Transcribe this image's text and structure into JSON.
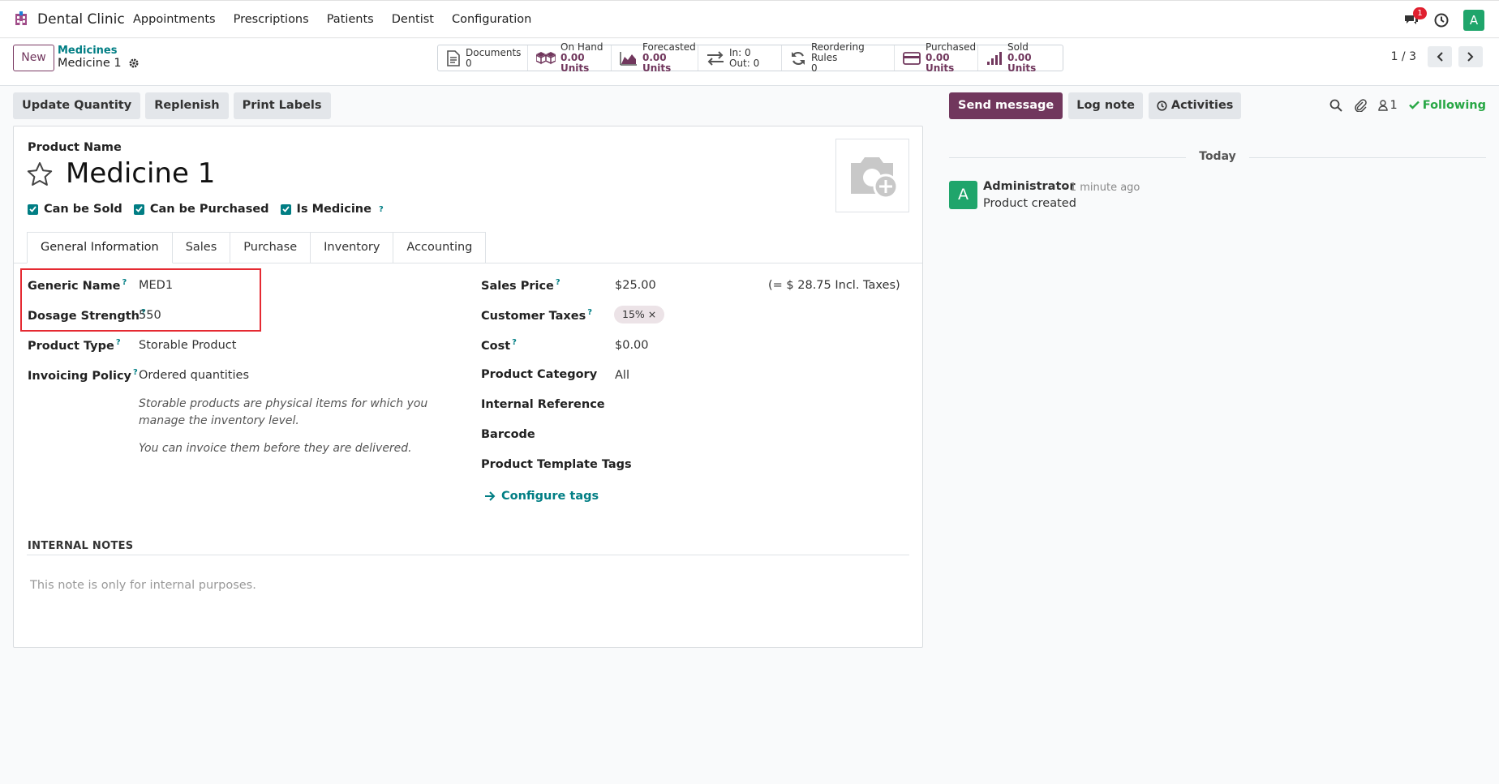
{
  "navbar": {
    "brand": "Dental Clinic",
    "menu": [
      "Appointments",
      "Prescriptions",
      "Patients",
      "Dentist",
      "Configuration"
    ],
    "chat_badge": "1",
    "user_initial": "A"
  },
  "control_panel": {
    "new_label": "New",
    "breadcrumb_parent": "Medicines",
    "breadcrumb_current": "Medicine 1",
    "smart_buttons": {
      "documents": {
        "label": "Documents",
        "value": "0"
      },
      "on_hand": {
        "label": "On Hand",
        "value": "0.00 Units"
      },
      "forecasted": {
        "label": "Forecasted",
        "value": "0.00 Units"
      },
      "in_out": {
        "in": "In: 0",
        "out": "Out: 0"
      },
      "reordering": {
        "label": "Reordering Rules",
        "value": "0"
      },
      "purchased": {
        "label": "Purchased",
        "value": "0.00 Units"
      },
      "sold": {
        "label": "Sold",
        "value": "0.00 Units"
      }
    },
    "pager": "1 / 3"
  },
  "actions": {
    "update_quantity": "Update Quantity",
    "replenish": "Replenish",
    "print_labels": "Print Labels"
  },
  "form": {
    "product_name_label": "Product Name",
    "product_name": "Medicine 1",
    "checkboxes": {
      "can_be_sold": "Can be Sold",
      "can_be_purchased": "Can be Purchased",
      "is_medicine": "Is Medicine"
    },
    "tabs": [
      "General Information",
      "Sales",
      "Purchase",
      "Inventory",
      "Accounting"
    ],
    "left": {
      "generic_name_label": "Generic Name",
      "generic_name": "MED1",
      "dosage_label": "Dosage Strength",
      "dosage": "550",
      "product_type_label": "Product Type",
      "product_type": "Storable Product",
      "invoicing_label": "Invoicing Policy",
      "invoicing": "Ordered quantities",
      "help_1": "Storable products are physical items for which you manage the inventory level.",
      "help_2": "You can invoice them before they are delivered."
    },
    "right": {
      "sales_price_label": "Sales Price",
      "sales_price": "$25.00",
      "incl_taxes": "(= $ 28.75 Incl. Taxes)",
      "customer_taxes_label": "Customer Taxes",
      "customer_tax_tag": "15% ×",
      "cost_label": "Cost",
      "cost": "$0.00",
      "category_label": "Product Category",
      "category": "All",
      "internal_ref_label": "Internal Reference",
      "barcode_label": "Barcode",
      "tags_label": "Product Template Tags",
      "configure_tags": "Configure tags"
    },
    "notes_heading": "INTERNAL NOTES",
    "notes_placeholder": "This note is only for internal purposes."
  },
  "chatter": {
    "send_message": "Send message",
    "log_note": "Log note",
    "activities": "Activities",
    "followers_count": "1",
    "following": "Following",
    "today": "Today",
    "message": {
      "avatar": "A",
      "author": "Administrator",
      "time": "- 1 minute ago",
      "body": "Product created"
    }
  },
  "colors": {
    "primary": "#71375d",
    "teal": "#017e84",
    "green": "#28a745",
    "highlight_red": "#e52a32"
  }
}
